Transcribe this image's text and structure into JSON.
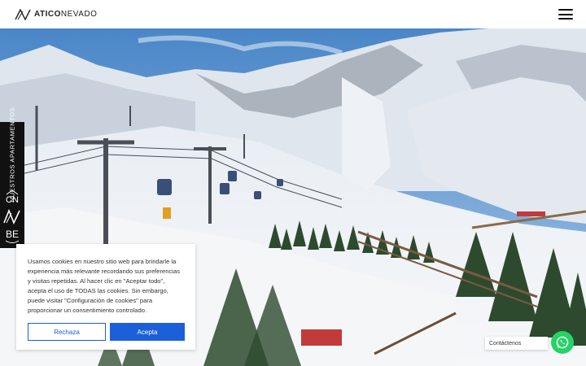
{
  "header": {
    "brand_first": "ATICO",
    "brand_second": "NEVADO",
    "menu_icon": "hamburger-menu-icon"
  },
  "side": {
    "label": "NUESTROS APARTAMENTOS",
    "items": [
      {
        "label": "CN",
        "icon": "cn-icon"
      },
      {
        "label": "",
        "icon": "aticonevado-mark-icon"
      },
      {
        "label": "BE",
        "icon": "be-icon"
      }
    ]
  },
  "cookie": {
    "text": "Usamos cookies en nuestro sitio web para brindarle la experiencia más relevante recordando sus preferencias y visitas repetidas. Al hacer clic en \"Aceptar todo\", acepta el uso de TODAS las cookies. Sin embargo, puede visitar \"Configuración de cookies\" para proporcionar un consentimiento controlado.",
    "reject_label": "Rechaza",
    "accept_label": "Acepta"
  },
  "contact": {
    "label": "Contáctenos",
    "icon": "whatsapp-icon"
  },
  "colors": {
    "accent": "#1b5fd9",
    "whatsapp": "#25d366",
    "side_bg": "#111111"
  }
}
